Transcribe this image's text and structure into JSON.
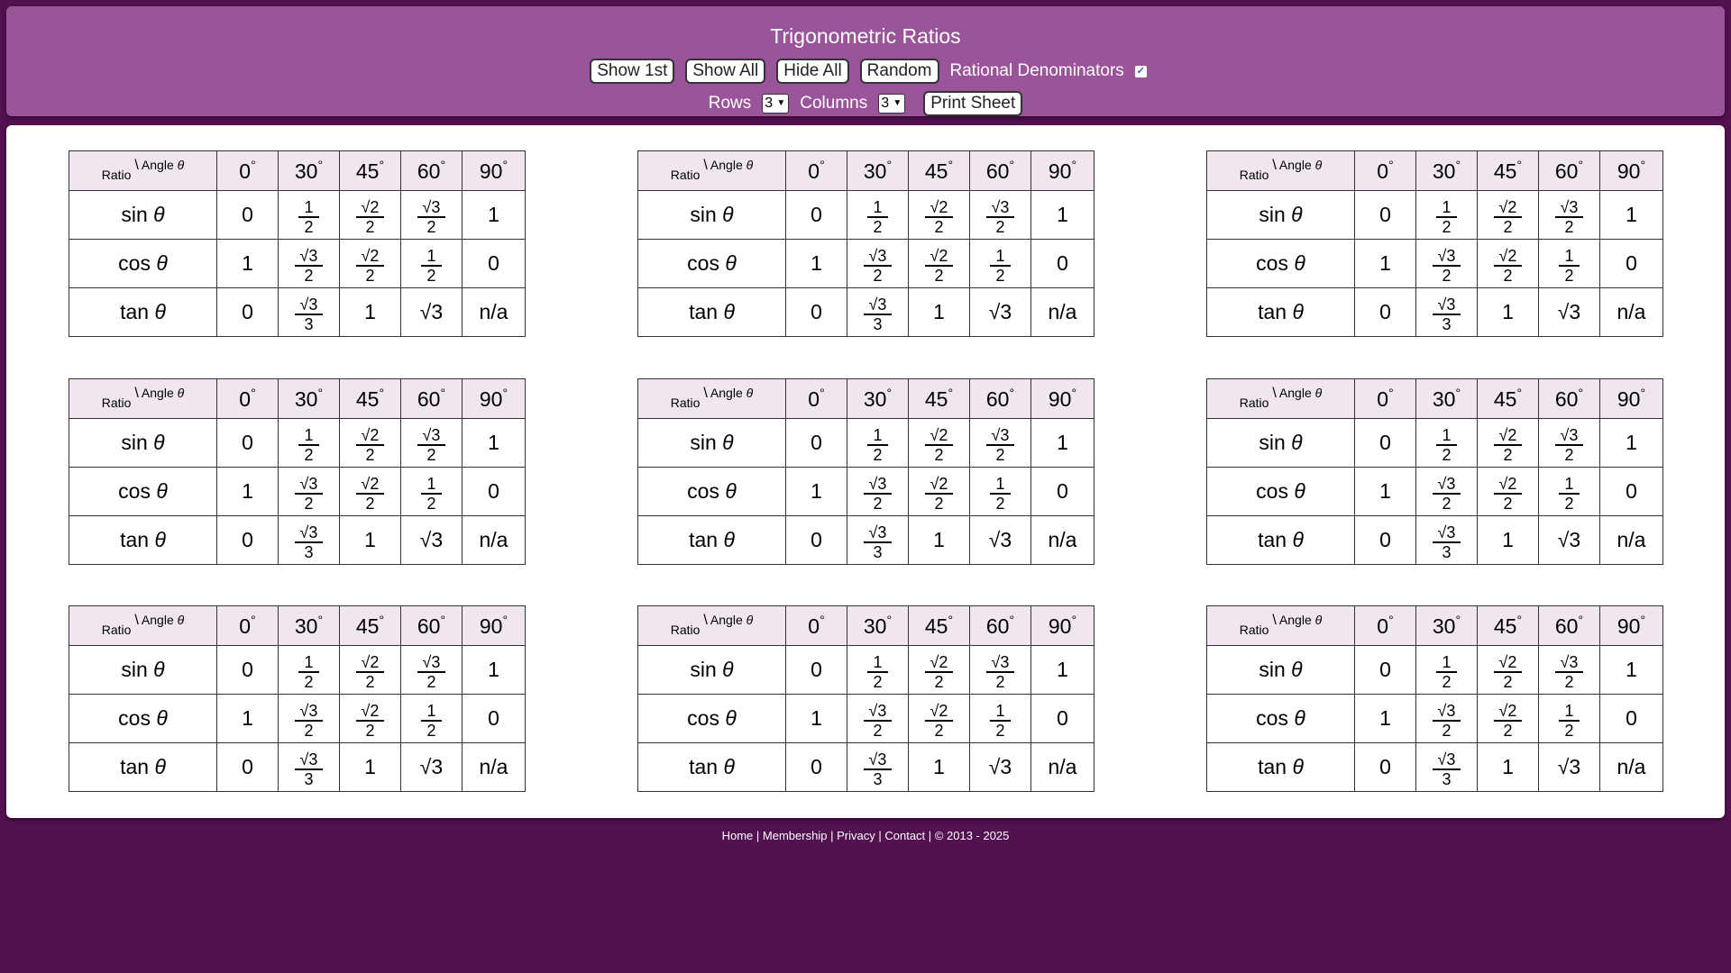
{
  "header": {
    "title": "Trigonometric Ratios",
    "buttons": {
      "show_first": "Show 1st",
      "show_all": "Show All",
      "hide_all": "Hide All",
      "random": "Random",
      "print_sheet": "Print Sheet"
    },
    "rational_label": "Rational Denominators",
    "rational_checked": true,
    "rows_label": "Rows",
    "rows_value": "3",
    "columns_label": "Columns",
    "columns_value": "3"
  },
  "table": {
    "corner_ratio": "Ratio",
    "corner_sep": "\\",
    "corner_angle": "Angle",
    "theta": "θ",
    "degree": "°",
    "angles": [
      "0",
      "30",
      "45",
      "60",
      "90"
    ],
    "rows": [
      {
        "fn": "sin",
        "cells": [
          {
            "v": "0"
          },
          {
            "num": "1",
            "den": "2"
          },
          {
            "num": "√2",
            "den": "2"
          },
          {
            "num": "√3",
            "den": "2"
          },
          {
            "v": "1"
          }
        ]
      },
      {
        "fn": "cos",
        "cells": [
          {
            "v": "1"
          },
          {
            "num": "√3",
            "den": "2"
          },
          {
            "num": "√2",
            "den": "2"
          },
          {
            "num": "1",
            "den": "2"
          },
          {
            "v": "0"
          }
        ]
      },
      {
        "fn": "tan",
        "cells": [
          {
            "v": "0"
          },
          {
            "num": "√3",
            "den": "3"
          },
          {
            "v": "1"
          },
          {
            "v": "√3"
          },
          {
            "v": "n/a"
          }
        ]
      }
    ]
  },
  "grid": {
    "rows": 3,
    "columns": 3
  },
  "footer": {
    "links": [
      "Home",
      "Membership",
      "Privacy",
      "Contact"
    ],
    "separator": "|",
    "copyright": "© 2013 - 2025"
  },
  "colors": {
    "background": "#531152",
    "header": "#9a5499",
    "table_header": "#efe6ef"
  }
}
